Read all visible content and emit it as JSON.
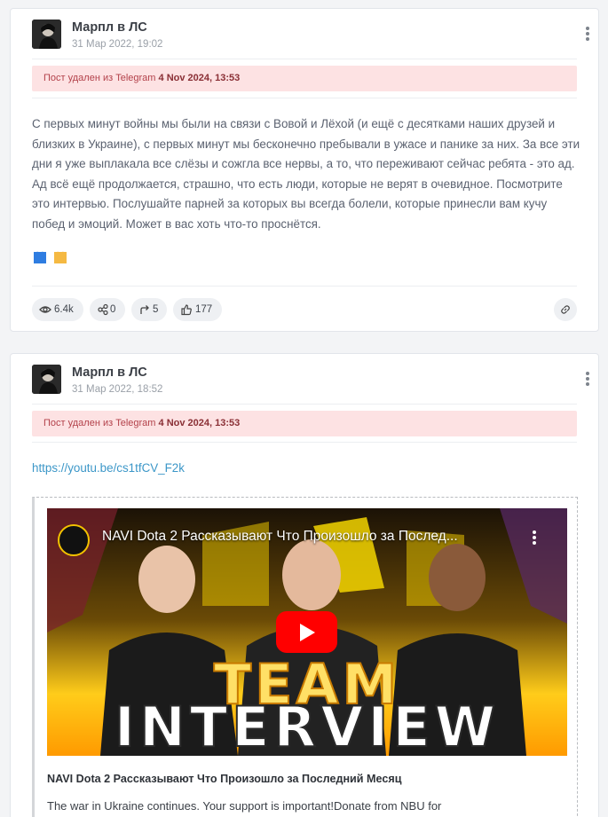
{
  "posts": [
    {
      "author": "Марпл в ЛС",
      "date": "31 Мар 2022, 19:02",
      "alert_prefix": "Пост удален из Telegram",
      "alert_date": "4 Nov 2024, 13:53",
      "text": "С первых минут войны мы были на связи с Вовой и Лёхой (и ещё с десятками наших друзей и близких в Украине), с первых минут мы бесконечно пребывали в ужасе и панике за них. За все эти дни я уже выплакала все слёзы и сожгла все нервы, а то, что переживают сейчас ребята - это ад. Ад всё ещё продолжается, страшно, что есть люди, которые не верят в очевидное. Посмотрите это интервью. Послушайте парней за которых вы всегда болели, которые принесли вам кучу побед и эмоций. Может в вас хоть что-то проснётся.",
      "emojis": [
        "blue-heart",
        "yellow-heart"
      ],
      "stats": {
        "views": "6.4k",
        "shares": "0",
        "reposts": "5",
        "likes": "177"
      }
    },
    {
      "author": "Марпл в ЛС",
      "date": "31 Мар 2022, 18:52",
      "alert_prefix": "Пост удален из Telegram",
      "alert_date": "4 Nov 2024, 13:53",
      "link": "https://youtu.be/cs1tfCV_F2k",
      "embed": {
        "video_title": "NAVI Dota 2 Рассказывают Что Произошло за Послед...",
        "thumb_line1": "TEAM",
        "thumb_line2": "INTERVIEW",
        "title": "NAVI Dota 2 Рассказывают Что Произошло за Последний Месяц",
        "description": "The war in Ukraine continues. Your support is important!Donate from NBU for"
      }
    }
  ],
  "colors": {
    "alert_bg": "#fde2e3",
    "link": "#3c97c8",
    "heart_blue": "#2f7de1",
    "heart_yellow": "#f5b942"
  }
}
